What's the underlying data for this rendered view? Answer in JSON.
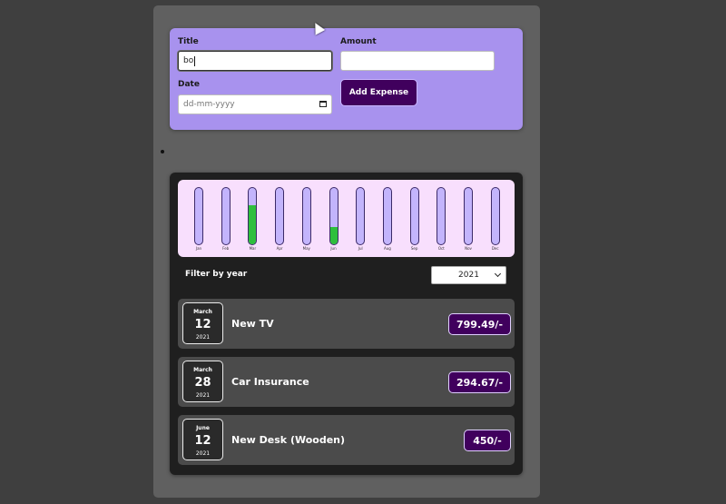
{
  "form": {
    "title_label": "Title",
    "title_value": "bo",
    "amount_label": "Amount",
    "amount_value": "",
    "date_label": "Date",
    "date_placeholder": "dd-mm-yyyy",
    "add_button_label": "Add Expense"
  },
  "chart": {
    "months": [
      {
        "label": "Jan",
        "fill": 0
      },
      {
        "label": "Feb",
        "fill": 0
      },
      {
        "label": "Mar",
        "fill": 0.7
      },
      {
        "label": "Apr",
        "fill": 0
      },
      {
        "label": "May",
        "fill": 0
      },
      {
        "label": "Jun",
        "fill": 0.3
      },
      {
        "label": "Jul",
        "fill": 0
      },
      {
        "label": "Aug",
        "fill": 0
      },
      {
        "label": "Sep",
        "fill": 0
      },
      {
        "label": "Oct",
        "fill": 0
      },
      {
        "label": "Nov",
        "fill": 0
      },
      {
        "label": "Dec",
        "fill": 0
      }
    ],
    "fill_color": "#2ebf3c"
  },
  "filter": {
    "label": "Filter by year",
    "selected_year": "2021"
  },
  "expenses": [
    {
      "month": "March",
      "day": "12",
      "year": "2021",
      "title": "New TV",
      "price": "799.49/-"
    },
    {
      "month": "March",
      "day": "28",
      "year": "2021",
      "title": "Car Insurance",
      "price": "294.67/-"
    },
    {
      "month": "June",
      "day": "12",
      "year": "2021",
      "title": "New Desk (Wooden)",
      "price": "450/-"
    }
  ],
  "colors": {
    "form_bg": "#a892ee",
    "button_bg": "#40005d",
    "panel_bg": "#1f1f1f",
    "item_bg": "#4b4b4b",
    "chart_bg": "#f8dffd"
  }
}
